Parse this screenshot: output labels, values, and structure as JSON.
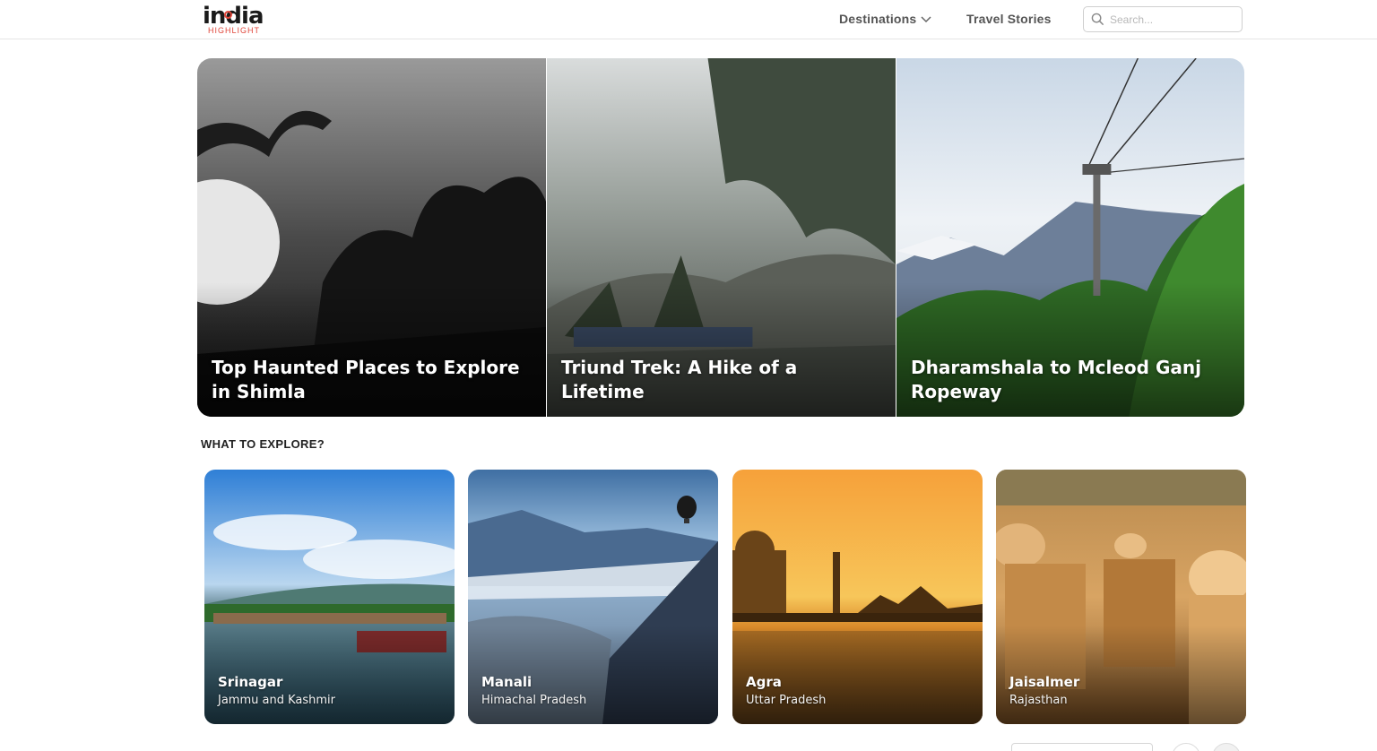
{
  "brand": {
    "logo_word": "india",
    "logo_sub": "HIGHLIGHT"
  },
  "nav": {
    "destinations_label": "Destinations",
    "travel_stories_label": "Travel Stories"
  },
  "search": {
    "placeholder": "Search..."
  },
  "hero": {
    "cards": [
      {
        "title": "Top Haunted Places to Explore in Shimla"
      },
      {
        "title": "Triund Trek: A Hike of a Lifetime"
      },
      {
        "title": "Dharamshala to Mcleod Ganj Ropeway"
      }
    ]
  },
  "explore": {
    "heading": "WHAT TO EXPLORE?",
    "destinations": [
      {
        "name": "Srinagar",
        "state": "Jammu and Kashmir"
      },
      {
        "name": "Manali",
        "state": "Himachal Pradesh"
      },
      {
        "name": "Agra",
        "state": "Uttar Pradesh"
      },
      {
        "name": "Jaisalmer",
        "state": "Rajasthan"
      }
    ]
  },
  "colors": {
    "brand_red": "#e0463a",
    "nav_text": "#555555",
    "border": "#e6e6e6"
  }
}
